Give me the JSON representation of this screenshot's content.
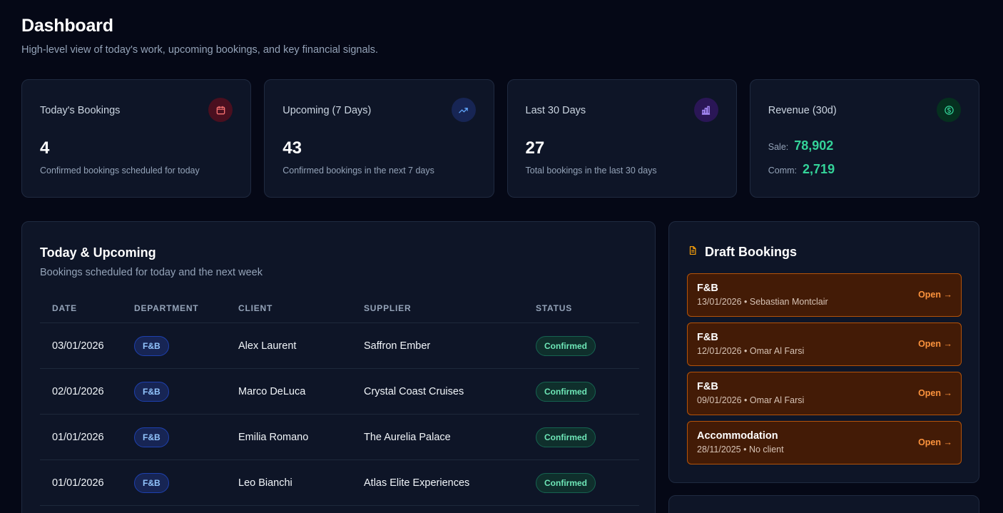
{
  "header": {
    "title": "Dashboard",
    "subtitle": "High-level view of today's work, upcoming bookings, and key financial signals."
  },
  "stats": {
    "today": {
      "title": "Today's Bookings",
      "value": "4",
      "desc": "Confirmed bookings scheduled for today",
      "icon": "calendar-icon",
      "color": "#f87171"
    },
    "upcoming": {
      "title": "Upcoming (7 Days)",
      "value": "43",
      "desc": "Confirmed bookings in the next 7 days",
      "icon": "trending-up-icon",
      "color": "#60a5fa"
    },
    "last30": {
      "title": "Last 30 Days",
      "value": "27",
      "desc": "Total bookings in the last 30 days",
      "icon": "bar-chart-icon",
      "color": "#a78bfa"
    },
    "revenue": {
      "title": "Revenue (30d)",
      "sale_label": "Sale:",
      "sale_value": "78,902",
      "comm_label": "Comm:",
      "comm_value": "2,719",
      "icon": "dollar-icon",
      "color": "#34d399"
    }
  },
  "upcoming_panel": {
    "title": "Today & Upcoming",
    "subtitle": "Bookings scheduled for today and the next week",
    "columns": [
      "DATE",
      "DEPARTMENT",
      "CLIENT",
      "SUPPLIER",
      "STATUS"
    ],
    "rows": [
      {
        "date": "03/01/2026",
        "department": "F&B",
        "client": "Alex Laurent",
        "supplier": "Saffron Ember",
        "status": "Confirmed"
      },
      {
        "date": "02/01/2026",
        "department": "F&B",
        "client": "Marco DeLuca",
        "supplier": "Crystal Coast Cruises",
        "status": "Confirmed"
      },
      {
        "date": "01/01/2026",
        "department": "F&B",
        "client": "Emilia Romano",
        "supplier": "The Aurelia Palace",
        "status": "Confirmed"
      },
      {
        "date": "01/01/2026",
        "department": "F&B",
        "client": "Leo Bianchi",
        "supplier": "Atlas Elite Experiences",
        "status": "Confirmed"
      }
    ]
  },
  "drafts": {
    "title": "Draft Bookings",
    "icon": "document-icon",
    "items": [
      {
        "name": "F&B",
        "meta": "13/01/2026 • Sebastian Montclair",
        "action": "Open →"
      },
      {
        "name": "F&B",
        "meta": "12/01/2026 • Omar Al Farsi",
        "action": "Open →"
      },
      {
        "name": "F&B",
        "meta": "09/01/2026 • Omar Al Farsi",
        "action": "Open →"
      },
      {
        "name": "Accommodation",
        "meta": "28/11/2025 • No client",
        "action": "Open →"
      }
    ]
  }
}
